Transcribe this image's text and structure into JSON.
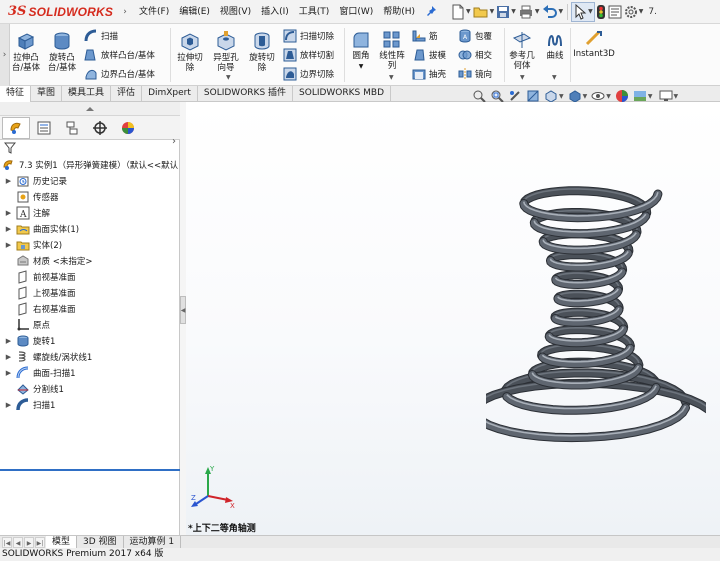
{
  "app": {
    "logo_ds": "3S",
    "logo_text": "SOLIDWORKS",
    "version_prefix": "7.",
    "status_text": "SOLIDWORKS Premium 2017 x64 版"
  },
  "menu": {
    "toggle": "›",
    "items": [
      "文件(F)",
      "编辑(E)",
      "视图(V)",
      "插入(I)",
      "工具(T)",
      "窗口(W)",
      "帮助(H)"
    ]
  },
  "ribbon": {
    "features": {
      "extrude_boss": "拉伸凸\n台/基体",
      "revolve_boss": "旋转凸\n台/基体",
      "sweep": "扫描",
      "loft_boss": "放样凸台/基体",
      "boundary_boss": "边界凸台/基体",
      "extrude_cut": "拉伸切\n除",
      "hole_wizard": "异型孔\n向导",
      "revolve_cut": "旋转切\n除",
      "swept_cut": "扫描切除",
      "lofted_cut": "放样切割",
      "boundary_cut": "边界切除",
      "fillet": "圆角",
      "linear_pattern": "线性阵\n列",
      "rib": "筋",
      "draft": "拔模",
      "shell": "抽壳",
      "wrap": "包覆",
      "intersect": "相交",
      "mirror": "镜向",
      "ref_geometry": "参考几\n何体",
      "curves": "曲线",
      "instant3d": "Instant3D"
    }
  },
  "command_tabs": [
    "特征",
    "草图",
    "模具工具",
    "评估",
    "DimXpert",
    "SOLIDWORKS 插件",
    "SOLIDWORKS MBD"
  ],
  "active_tab_index": 0,
  "feature_tree": {
    "root": "7.3 实例1（异形弹簧建模）（默认<<默认",
    "items": [
      {
        "label": "历史记录",
        "icon": "history-folder-icon",
        "expandable": true
      },
      {
        "label": "传感器",
        "icon": "sensor-icon",
        "expandable": false
      },
      {
        "label": "注解",
        "icon": "annotation-icon",
        "expandable": true
      },
      {
        "label": "曲面实体(1)",
        "icon": "surface-bodies-folder-icon",
        "expandable": true
      },
      {
        "label": "实体(2)",
        "icon": "solid-bodies-folder-icon",
        "expandable": true
      },
      {
        "label": "材质 <未指定>",
        "icon": "material-icon",
        "expandable": false
      },
      {
        "label": "前视基准面",
        "icon": "plane-icon",
        "expandable": false
      },
      {
        "label": "上视基准面",
        "icon": "plane-icon",
        "expandable": false
      },
      {
        "label": "右视基准面",
        "icon": "plane-icon",
        "expandable": false
      },
      {
        "label": "原点",
        "icon": "origin-icon",
        "expandable": false
      },
      {
        "label": "旋转1",
        "icon": "revolve-feature-icon",
        "expandable": true
      },
      {
        "label": "螺旋线/涡状线1",
        "icon": "helix-icon",
        "expandable": true
      },
      {
        "label": "曲面-扫描1",
        "icon": "surface-sweep-icon",
        "expandable": true
      },
      {
        "label": "分割线1",
        "icon": "split-line-icon",
        "expandable": false
      },
      {
        "label": "扫描1",
        "icon": "sweep-feature-icon",
        "expandable": true
      }
    ]
  },
  "viewport": {
    "view_name": "*上下二等角轴测",
    "triad": {
      "x": "X",
      "y": "Y",
      "z": "Z"
    },
    "colors": {
      "spring": "#5f6670",
      "triad_x": "#d0242a",
      "triad_y": "#2aa84a",
      "triad_z": "#2a55d0"
    }
  },
  "bottom_tabs": [
    "模型",
    "3D 视图",
    "运动算例 1"
  ],
  "active_bottom_tab_index": 0
}
